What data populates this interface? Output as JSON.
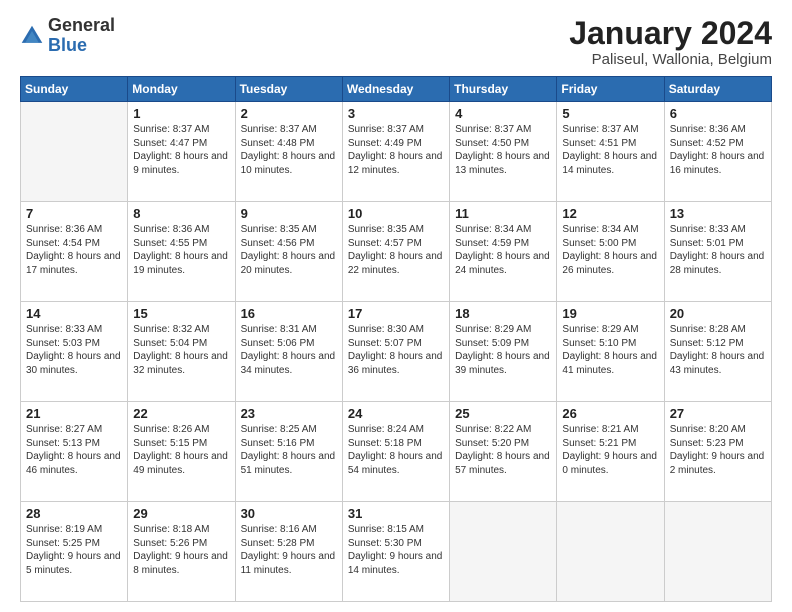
{
  "header": {
    "logo_general": "General",
    "logo_blue": "Blue",
    "month_title": "January 2024",
    "subtitle": "Paliseul, Wallonia, Belgium"
  },
  "weekdays": [
    "Sunday",
    "Monday",
    "Tuesday",
    "Wednesday",
    "Thursday",
    "Friday",
    "Saturday"
  ],
  "weeks": [
    [
      {
        "num": "",
        "detail": ""
      },
      {
        "num": "1",
        "detail": "Sunrise: 8:37 AM\nSunset: 4:47 PM\nDaylight: 8 hours\nand 9 minutes."
      },
      {
        "num": "2",
        "detail": "Sunrise: 8:37 AM\nSunset: 4:48 PM\nDaylight: 8 hours\nand 10 minutes."
      },
      {
        "num": "3",
        "detail": "Sunrise: 8:37 AM\nSunset: 4:49 PM\nDaylight: 8 hours\nand 12 minutes."
      },
      {
        "num": "4",
        "detail": "Sunrise: 8:37 AM\nSunset: 4:50 PM\nDaylight: 8 hours\nand 13 minutes."
      },
      {
        "num": "5",
        "detail": "Sunrise: 8:37 AM\nSunset: 4:51 PM\nDaylight: 8 hours\nand 14 minutes."
      },
      {
        "num": "6",
        "detail": "Sunrise: 8:36 AM\nSunset: 4:52 PM\nDaylight: 8 hours\nand 16 minutes."
      }
    ],
    [
      {
        "num": "7",
        "detail": "Sunrise: 8:36 AM\nSunset: 4:54 PM\nDaylight: 8 hours\nand 17 minutes."
      },
      {
        "num": "8",
        "detail": "Sunrise: 8:36 AM\nSunset: 4:55 PM\nDaylight: 8 hours\nand 19 minutes."
      },
      {
        "num": "9",
        "detail": "Sunrise: 8:35 AM\nSunset: 4:56 PM\nDaylight: 8 hours\nand 20 minutes."
      },
      {
        "num": "10",
        "detail": "Sunrise: 8:35 AM\nSunset: 4:57 PM\nDaylight: 8 hours\nand 22 minutes."
      },
      {
        "num": "11",
        "detail": "Sunrise: 8:34 AM\nSunset: 4:59 PM\nDaylight: 8 hours\nand 24 minutes."
      },
      {
        "num": "12",
        "detail": "Sunrise: 8:34 AM\nSunset: 5:00 PM\nDaylight: 8 hours\nand 26 minutes."
      },
      {
        "num": "13",
        "detail": "Sunrise: 8:33 AM\nSunset: 5:01 PM\nDaylight: 8 hours\nand 28 minutes."
      }
    ],
    [
      {
        "num": "14",
        "detail": "Sunrise: 8:33 AM\nSunset: 5:03 PM\nDaylight: 8 hours\nand 30 minutes."
      },
      {
        "num": "15",
        "detail": "Sunrise: 8:32 AM\nSunset: 5:04 PM\nDaylight: 8 hours\nand 32 minutes."
      },
      {
        "num": "16",
        "detail": "Sunrise: 8:31 AM\nSunset: 5:06 PM\nDaylight: 8 hours\nand 34 minutes."
      },
      {
        "num": "17",
        "detail": "Sunrise: 8:30 AM\nSunset: 5:07 PM\nDaylight: 8 hours\nand 36 minutes."
      },
      {
        "num": "18",
        "detail": "Sunrise: 8:29 AM\nSunset: 5:09 PM\nDaylight: 8 hours\nand 39 minutes."
      },
      {
        "num": "19",
        "detail": "Sunrise: 8:29 AM\nSunset: 5:10 PM\nDaylight: 8 hours\nand 41 minutes."
      },
      {
        "num": "20",
        "detail": "Sunrise: 8:28 AM\nSunset: 5:12 PM\nDaylight: 8 hours\nand 43 minutes."
      }
    ],
    [
      {
        "num": "21",
        "detail": "Sunrise: 8:27 AM\nSunset: 5:13 PM\nDaylight: 8 hours\nand 46 minutes."
      },
      {
        "num": "22",
        "detail": "Sunrise: 8:26 AM\nSunset: 5:15 PM\nDaylight: 8 hours\nand 49 minutes."
      },
      {
        "num": "23",
        "detail": "Sunrise: 8:25 AM\nSunset: 5:16 PM\nDaylight: 8 hours\nand 51 minutes."
      },
      {
        "num": "24",
        "detail": "Sunrise: 8:24 AM\nSunset: 5:18 PM\nDaylight: 8 hours\nand 54 minutes."
      },
      {
        "num": "25",
        "detail": "Sunrise: 8:22 AM\nSunset: 5:20 PM\nDaylight: 8 hours\nand 57 minutes."
      },
      {
        "num": "26",
        "detail": "Sunrise: 8:21 AM\nSunset: 5:21 PM\nDaylight: 9 hours\nand 0 minutes."
      },
      {
        "num": "27",
        "detail": "Sunrise: 8:20 AM\nSunset: 5:23 PM\nDaylight: 9 hours\nand 2 minutes."
      }
    ],
    [
      {
        "num": "28",
        "detail": "Sunrise: 8:19 AM\nSunset: 5:25 PM\nDaylight: 9 hours\nand 5 minutes."
      },
      {
        "num": "29",
        "detail": "Sunrise: 8:18 AM\nSunset: 5:26 PM\nDaylight: 9 hours\nand 8 minutes."
      },
      {
        "num": "30",
        "detail": "Sunrise: 8:16 AM\nSunset: 5:28 PM\nDaylight: 9 hours\nand 11 minutes."
      },
      {
        "num": "31",
        "detail": "Sunrise: 8:15 AM\nSunset: 5:30 PM\nDaylight: 9 hours\nand 14 minutes."
      },
      {
        "num": "",
        "detail": ""
      },
      {
        "num": "",
        "detail": ""
      },
      {
        "num": "",
        "detail": ""
      }
    ]
  ]
}
